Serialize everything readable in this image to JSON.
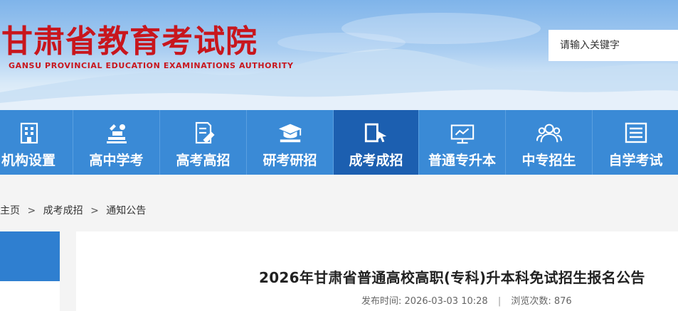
{
  "header": {
    "title_cn": "甘肃省教育考试院",
    "title_en": "GANSU PROVINCIAL EDUCATION EXAMINATIONS AUTHORITY",
    "brand_color": "#c8161d"
  },
  "search": {
    "placeholder": "请输入关键字"
  },
  "nav": {
    "color": "#3a8ad6",
    "active_color": "#1c5fb0",
    "items": [
      {
        "label": "机构设置",
        "icon": "building-icon"
      },
      {
        "label": "高中学考",
        "icon": "books-icon"
      },
      {
        "label": "高考高招",
        "icon": "document-pen-icon"
      },
      {
        "label": "研考研招",
        "icon": "graduation-cap-icon"
      },
      {
        "label": "成考成招",
        "icon": "book-cursor-icon",
        "active": true
      },
      {
        "label": "普通专升本",
        "icon": "presentation-icon"
      },
      {
        "label": "中专招生",
        "icon": "users-icon"
      },
      {
        "label": "自学考试",
        "icon": "list-doc-icon"
      }
    ]
  },
  "breadcrumb": {
    "home": "主页",
    "section": "成考成招",
    "current": "通知公告",
    "separator": ">"
  },
  "article": {
    "title": "2026年甘肃省普通高校高职(专科)升本科免试招生报名公告",
    "publish_label": "发布时间:",
    "publish_time": "2026-03-03 10:28",
    "divider": "|",
    "views_label": "浏览次数:",
    "views": "876"
  }
}
